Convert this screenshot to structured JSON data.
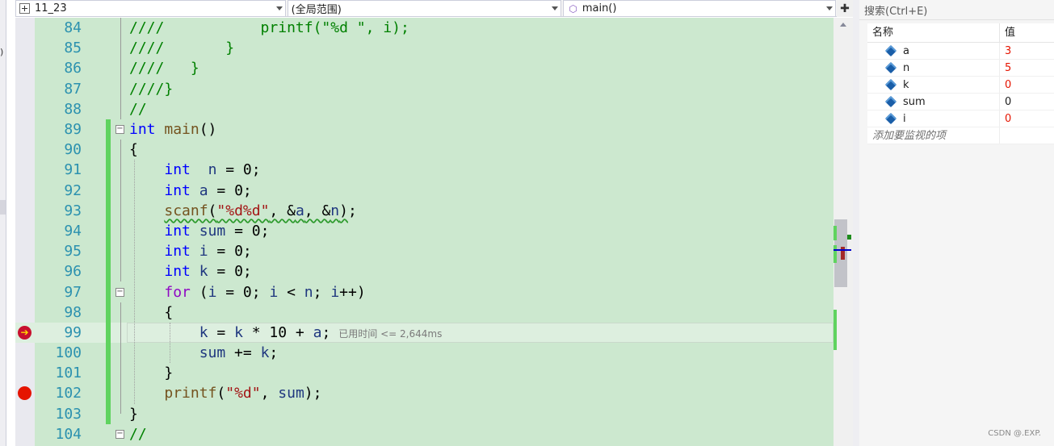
{
  "navigation": {
    "project": "11_23",
    "scope": "(全局范围)",
    "function": "main()"
  },
  "editor": {
    "lines": [
      {
        "num": "84",
        "html": "<span class=\"cm\">////           printf(\"%d \", i);</span>"
      },
      {
        "num": "85",
        "html": "<span class=\"cm\">////       }</span>"
      },
      {
        "num": "86",
        "html": "<span class=\"cm\">////   }</span>"
      },
      {
        "num": "87",
        "html": "<span class=\"cm\">////}</span>"
      },
      {
        "num": "88",
        "html": "<span class=\"cm\">//</span>"
      },
      {
        "num": "89",
        "html": "<span class=\"kw\">int</span> <span class=\"fn\">main</span>()"
      },
      {
        "num": "90",
        "html": "{"
      },
      {
        "num": "91",
        "html": "    <span class=\"kw\">int</span>  <span class=\"var\">n</span> = 0;"
      },
      {
        "num": "92",
        "html": "    <span class=\"kw\">int</span> <span class=\"var\">a</span> = 0;"
      },
      {
        "num": "93",
        "html": "    <span class=\"squiggle\"><span class=\"fn\">scanf</span>(<span class=\"str\">\"%d%d\"</span>, &amp;<span class=\"var\">a</span>, &amp;<span class=\"var\">n</span>)</span>;"
      },
      {
        "num": "94",
        "html": "    <span class=\"kw\">int</span> <span class=\"var\">sum</span> = 0;"
      },
      {
        "num": "95",
        "html": "    <span class=\"kw\">int</span> <span class=\"var\">i</span> = 0;"
      },
      {
        "num": "96",
        "html": "    <span class=\"kw\">int</span> <span class=\"var\">k</span> = 0;"
      },
      {
        "num": "97",
        "html": "    <span class=\"kw\" style=\"color:#8f08c4\">for</span> (<span class=\"var\">i</span> = 0; <span class=\"var\">i</span> &lt; <span class=\"var\">n</span>; <span class=\"var\">i</span>++)"
      },
      {
        "num": "98",
        "html": "    {"
      },
      {
        "num": "99",
        "html": "        <span class=\"var\">k</span> = <span class=\"var\">k</span> * 10 + <span class=\"var\">a</span>;<span class=\"hint\">已用时间 &lt;= 2,644ms</span>"
      },
      {
        "num": "100",
        "html": "        <span class=\"var\">sum</span> += <span class=\"var\">k</span>;"
      },
      {
        "num": "101",
        "html": "    }"
      },
      {
        "num": "102",
        "html": "    <span class=\"fn\">printf</span>(<span class=\"str\">\"%d\"</span>, <span class=\"var\">sum</span>);"
      },
      {
        "num": "103",
        "html": "}"
      },
      {
        "num": "104",
        "html": "<span class=\"cm\">//</span>"
      }
    ],
    "current_line": "99",
    "breakpoint_line": "102",
    "elapsed_hint": "已用时间 <= 2,644ms"
  },
  "watch": {
    "search_placeholder": "搜索(Ctrl+E)",
    "columns": {
      "name": "名称",
      "value": "值"
    },
    "rows": [
      {
        "name": "a",
        "value": "3",
        "changed": true
      },
      {
        "name": "n",
        "value": "5",
        "changed": true
      },
      {
        "name": "k",
        "value": "0",
        "changed": true
      },
      {
        "name": "sum",
        "value": "0",
        "changed": false
      },
      {
        "name": "i",
        "value": "0",
        "changed": true
      }
    ],
    "add_item_placeholder": "添加要监视的项"
  },
  "watermark": "CSDN @.EXP."
}
